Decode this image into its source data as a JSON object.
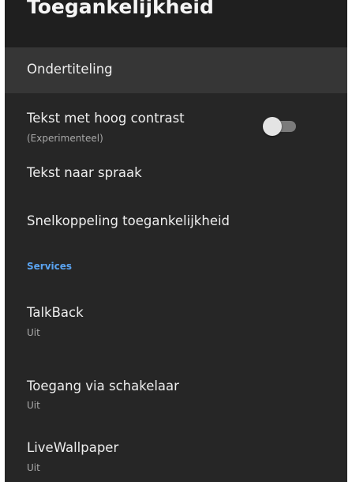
{
  "header": {
    "title": "Toegankelijkheid"
  },
  "items": {
    "captions": {
      "title": "Ondertiteling"
    },
    "high_contrast": {
      "title": "Tekst met hoog contrast",
      "subtitle": "(Experimenteel)",
      "toggle_on": false
    },
    "tts": {
      "title": "Tekst naar spraak"
    },
    "shortcut": {
      "title": "Snelkoppeling toegankelijkheid"
    }
  },
  "services": {
    "header": "Services",
    "items": [
      {
        "title": "TalkBack",
        "status": "Uit"
      },
      {
        "title": "Toegang via schakelaar",
        "status": "Uit"
      },
      {
        "title": "LiveWallpaper",
        "status": "Uit"
      }
    ]
  },
  "colors": {
    "background": "#262626",
    "selected_row": "#363636",
    "accent": "#5aa3f0"
  }
}
